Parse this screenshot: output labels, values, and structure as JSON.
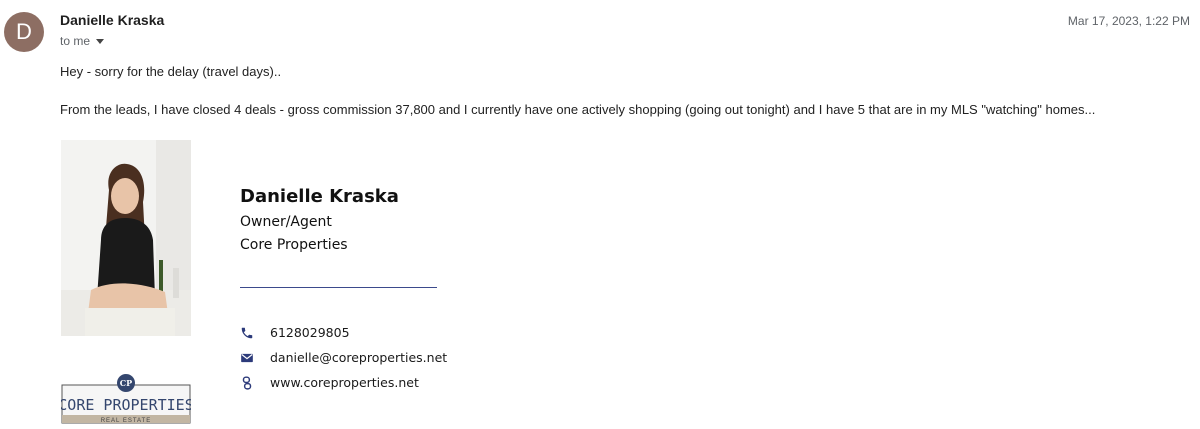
{
  "email": {
    "sender": {
      "name": "Danielle Kraska",
      "avatar_initial": "D",
      "avatar_color": "#8d6e63"
    },
    "recipient": "to me",
    "timestamp": "Mar 17, 2023, 1:22 PM",
    "body": {
      "line1": "Hey - sorry for the delay (travel days)..",
      "line2": "From the leads, I have closed 4 deals - gross commission 37,800 and I currently have one actively shopping (going out tonight) and I have 5 that are in my MLS \"watching\" homes..."
    }
  },
  "signature": {
    "name": "Danielle Kraska",
    "title": "Owner/Agent",
    "company": "Core Properties",
    "rule_color": "#3b4a8c",
    "icon_color": "#2c3a7a",
    "contacts": [
      {
        "icon": "phone-icon",
        "text": "6128029805"
      },
      {
        "icon": "mail-icon",
        "text": "danielle@coreproperties.net"
      },
      {
        "icon": "link-icon",
        "text": "www.coreproperties.net"
      }
    ],
    "logo": {
      "monogram": "CP",
      "wordmark": "CORE PROPERTIES",
      "tagline": "REAL ESTATE"
    }
  }
}
